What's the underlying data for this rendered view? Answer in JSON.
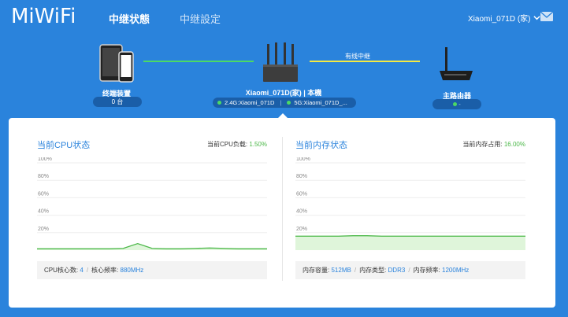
{
  "header": {
    "logo": "MiWiFi",
    "nav": [
      "中继状態",
      "中继設定"
    ],
    "device_name": "Xiaomi_071D (家)",
    "mail_icon": "mail-icon"
  },
  "topology": {
    "terminal": {
      "label": "终端装置",
      "count": "0 台"
    },
    "repeater": {
      "label": "Xiaomi_071D(家) | 本機",
      "wifi_24": "2.4G:Xiaomi_071D",
      "wifi_5": "5G:Xiaomi_071D_..."
    },
    "link_label": "有线中继",
    "main_router": {
      "label": "主路由器"
    }
  },
  "cpu": {
    "title": "当前CPU状态",
    "load_label": "当前CPU负载:",
    "load_value": "1.50%",
    "y_ticks": [
      "100%",
      "80%",
      "60%",
      "40%",
      "20%"
    ],
    "series": [
      1.5,
      1.5,
      1.5,
      1.5,
      1.5,
      1.5,
      2.0,
      7.5,
      2.0,
      1.5,
      1.5,
      2.0,
      2.5,
      2.0,
      1.5,
      1.5,
      1.5
    ],
    "cores_label": "CPU核心数:",
    "cores_value": "4",
    "freq_label": "核心频率:",
    "freq_value": "880MHz"
  },
  "memory": {
    "title": "当前内存状态",
    "usage_label": "当前内存占用:",
    "usage_value": "16.00%",
    "y_ticks": [
      "100%",
      "80%",
      "60%",
      "40%",
      "20%"
    ],
    "series": [
      16,
      16,
      16,
      16,
      16.5,
      16.5,
      16,
      16,
      16,
      16,
      16,
      16,
      16,
      16,
      16,
      16,
      16
    ],
    "capacity_label": "内存容量:",
    "capacity_value": "512MB",
    "type_label": "内存类型:",
    "type_value": "DDR3",
    "freq_label": "内存频率:",
    "freq_value": "1200MHz"
  },
  "colors": {
    "accent": "#2a83dc",
    "green": "#4cb849",
    "yellow": "#f5e942"
  }
}
